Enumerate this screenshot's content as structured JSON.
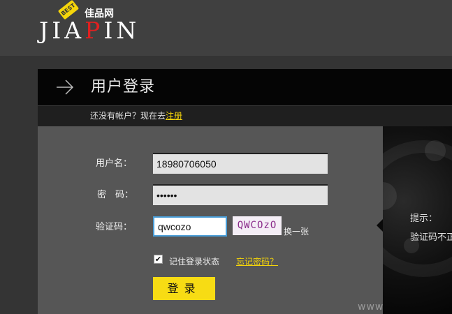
{
  "brand": {
    "name_cn": "佳品网",
    "wordmark_pre": "JIA",
    "wordmark_mid": "P",
    "wordmark_post": "IN",
    "badge": "BEST"
  },
  "panel": {
    "title": "用户登录",
    "no_account_text": "还没有帐户？现在去",
    "register_link": "注册"
  },
  "form": {
    "username_label": "用户名：",
    "username_value": "18980706050",
    "password_label": "密　码：",
    "password_value": "••••••",
    "captcha_label": "验证码：",
    "captcha_value": "qwcozo",
    "captcha_image_text": "QWCOzO",
    "refresh_label": "换一张",
    "remember_label": "记住登录状态",
    "remember_checked": true,
    "remember_mark": "✔",
    "forgot_link": "忘记密码？",
    "login_button": "登录"
  },
  "tip": {
    "label": "提示：",
    "text": "验证码不正确"
  },
  "watermark": "www",
  "colors": {
    "accent_yellow": "#f7dc14",
    "link_yellow": "#f5d50a",
    "form_bg": "#565656",
    "header_bg": "#050505",
    "topbar_bg": "#404040",
    "captcha_border": "#4a9ed8"
  }
}
